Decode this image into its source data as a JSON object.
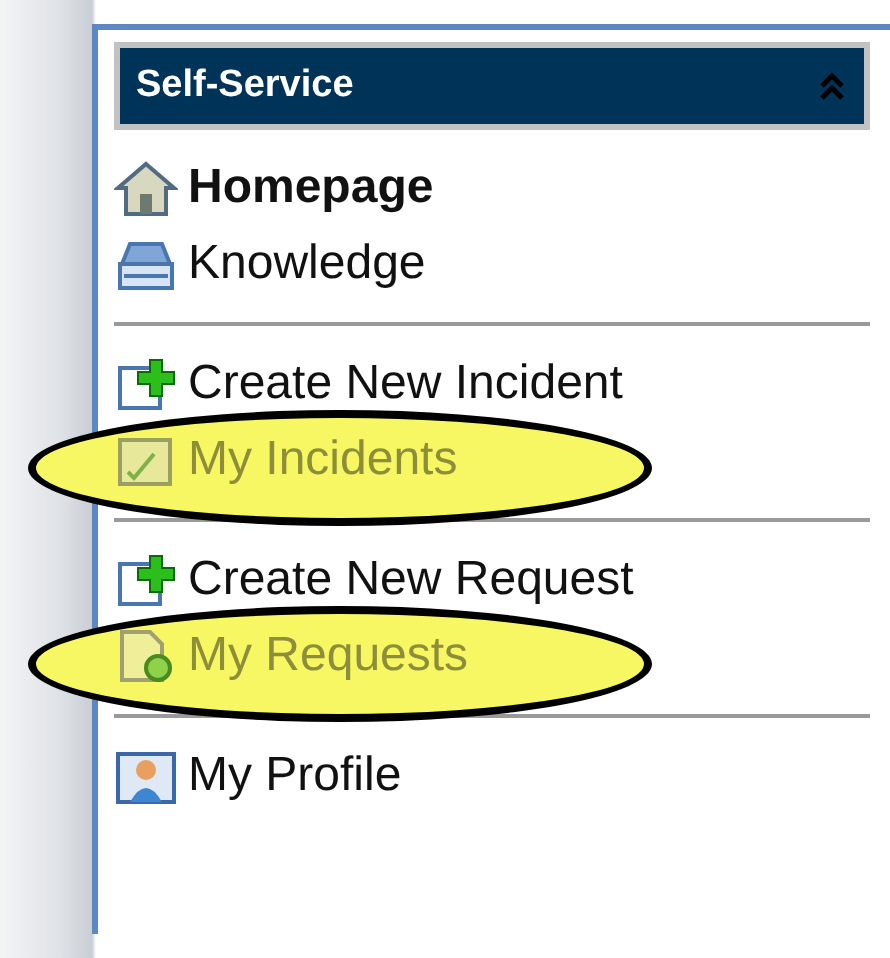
{
  "panel": {
    "title": "Self-Service"
  },
  "sections": [
    {
      "items": [
        {
          "kind": "home",
          "label": "Homepage",
          "bold": true,
          "highlighted": false
        },
        {
          "kind": "knowledge",
          "label": "Knowledge",
          "bold": false,
          "highlighted": false
        }
      ]
    },
    {
      "items": [
        {
          "kind": "create",
          "label": "Create New Incident",
          "bold": false,
          "highlighted": false
        },
        {
          "kind": "incidents",
          "label": "My Incidents",
          "bold": false,
          "highlighted": true
        }
      ]
    },
    {
      "items": [
        {
          "kind": "create",
          "label": "Create New Request",
          "bold": false,
          "highlighted": false
        },
        {
          "kind": "requests",
          "label": "My Requests",
          "bold": false,
          "highlighted": true
        }
      ]
    },
    {
      "items": [
        {
          "kind": "profile",
          "label": "My Profile",
          "bold": false,
          "highlighted": false
        }
      ]
    }
  ]
}
